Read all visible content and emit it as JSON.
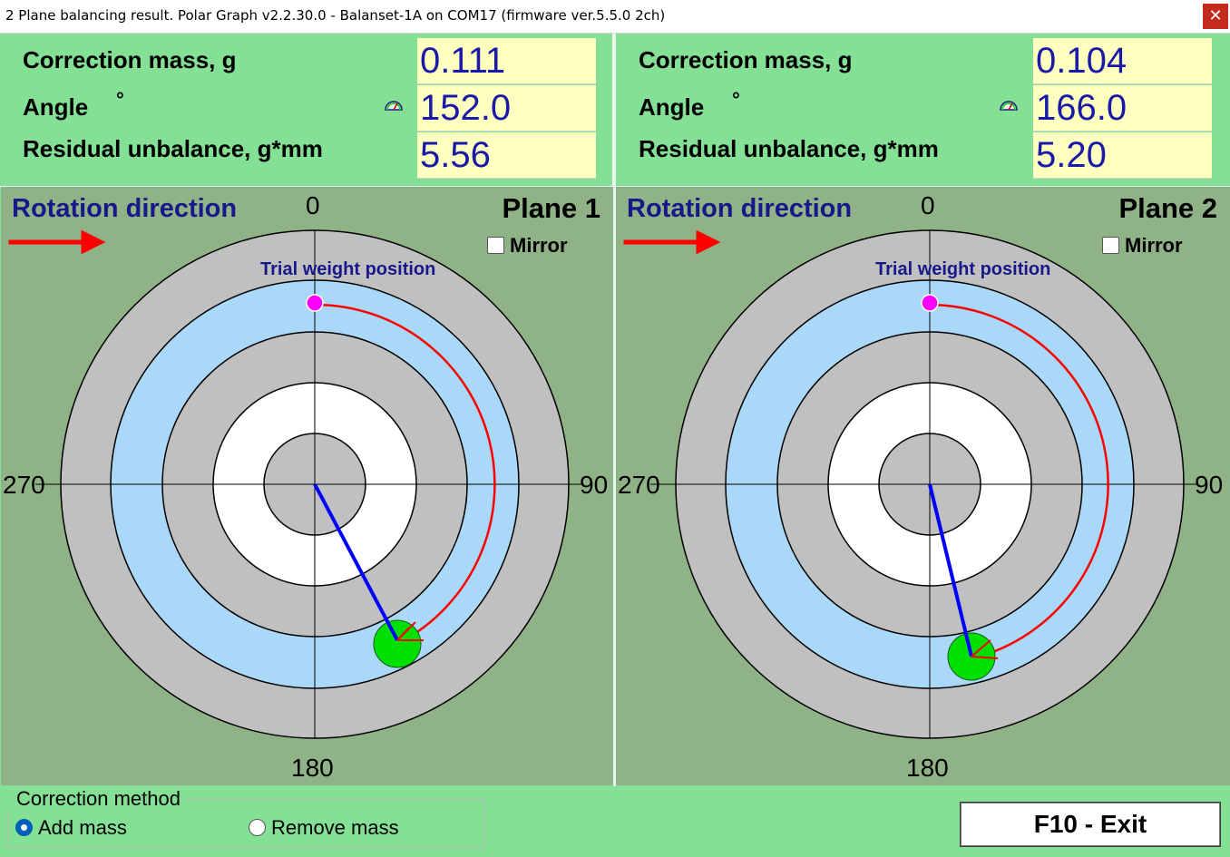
{
  "window": {
    "title": "2 Plane balancing result. Polar Graph v2.2.30.0 - Balanset-1A on COM17 (firmware ver.5.5.0 2ch)",
    "close_glyph": "✕"
  },
  "labels": {
    "correction_mass": "Correction mass, g",
    "angle": "Angle",
    "degree_symbol": "°",
    "residual_unbalance": "Residual unbalance, g*mm",
    "rotation_direction": "Rotation direction",
    "mirror": "Mirror",
    "trial_weight_position": "Trial weight position",
    "axis_0": "0",
    "axis_90": "90",
    "axis_180": "180",
    "axis_270": "270"
  },
  "planes": [
    {
      "title": "Plane 1",
      "correction_mass": "0.111",
      "angle": "152.0",
      "residual_unbalance": "5.56",
      "mirror_checked": false
    },
    {
      "title": "Plane 2",
      "correction_mass": "0.104",
      "angle": "166.0",
      "residual_unbalance": "5.20",
      "mirror_checked": false
    }
  ],
  "correction_method": {
    "legend": "Correction method",
    "options": [
      {
        "label": "Add mass",
        "selected": true
      },
      {
        "label": "Remove mass",
        "selected": false
      }
    ]
  },
  "exit_button": {
    "label": "F10 - Exit"
  },
  "icons": {
    "angle_gauge": "gauge-icon",
    "rotation_arrow": "arrow-right-icon",
    "close": "close-icon"
  },
  "colors": {
    "panel_bg": "#84e095",
    "chart_bg": "#8fb386",
    "value_box_bg": "#ffffc0",
    "value_text": "#1a1aa8",
    "ring_gray": "#c0c0c0",
    "ring_blue": "#aad8f8",
    "ring_white": "#ffffff",
    "vector_blue": "#0000ff",
    "arc_red": "#ff0000",
    "trial_marker": "#ff00ff",
    "correction_marker": "#00e000"
  }
}
